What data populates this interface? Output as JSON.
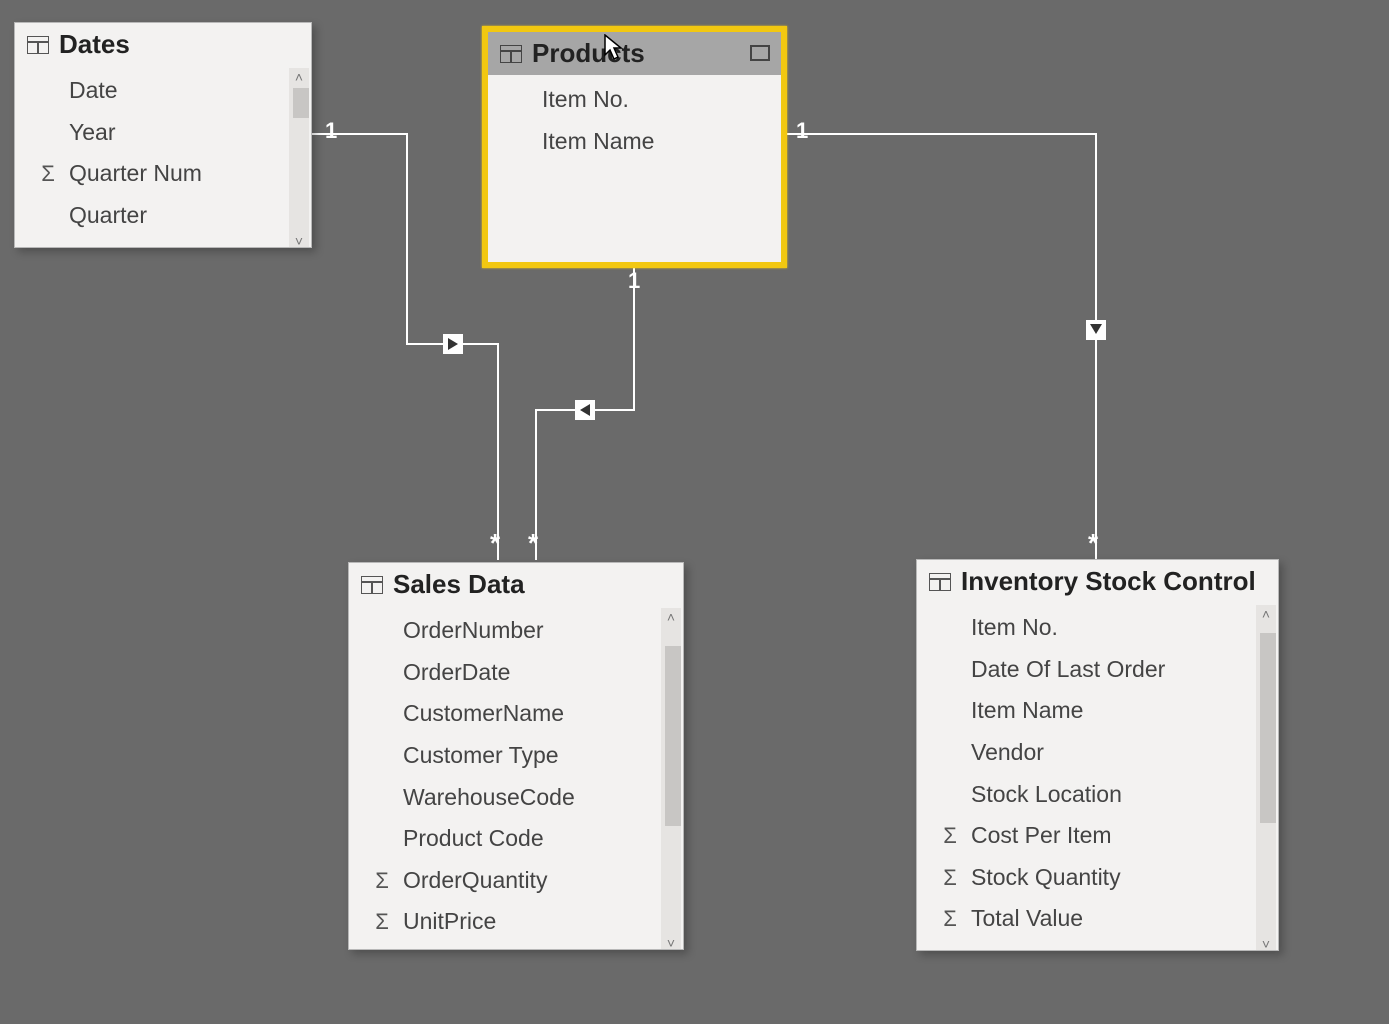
{
  "tables": {
    "dates": {
      "title": "Dates",
      "fields": [
        {
          "label": "Date",
          "sigma": false
        },
        {
          "label": "Year",
          "sigma": false
        },
        {
          "label": "Quarter Num",
          "sigma": true
        },
        {
          "label": "Quarter",
          "sigma": false
        }
      ]
    },
    "products": {
      "title": "Products",
      "fields": [
        {
          "label": "Item No.",
          "sigma": false
        },
        {
          "label": "Item Name",
          "sigma": false
        }
      ]
    },
    "sales": {
      "title": "Sales Data",
      "fields": [
        {
          "label": "OrderNumber",
          "sigma": false
        },
        {
          "label": "OrderDate",
          "sigma": false
        },
        {
          "label": "CustomerName",
          "sigma": false
        },
        {
          "label": "Customer Type",
          "sigma": false
        },
        {
          "label": "WarehouseCode",
          "sigma": false
        },
        {
          "label": "Product Code",
          "sigma": false
        },
        {
          "label": "OrderQuantity",
          "sigma": true
        },
        {
          "label": "UnitPrice",
          "sigma": true
        }
      ]
    },
    "inventory": {
      "title": "Inventory Stock Control",
      "fields": [
        {
          "label": "Item No.",
          "sigma": false
        },
        {
          "label": "Date Of Last Order",
          "sigma": false
        },
        {
          "label": "Item Name",
          "sigma": false
        },
        {
          "label": "Vendor",
          "sigma": false
        },
        {
          "label": "Stock Location",
          "sigma": false
        },
        {
          "label": "Cost Per Item",
          "sigma": true
        },
        {
          "label": "Stock Quantity",
          "sigma": true
        },
        {
          "label": "Total Value",
          "sigma": true
        }
      ]
    }
  },
  "relationships": {
    "dates_sales": {
      "from_card": "1",
      "to_card": "*"
    },
    "products_sales": {
      "from_card": "1",
      "to_card": "*"
    },
    "products_inv": {
      "from_card": "1",
      "to_card": "*"
    }
  }
}
